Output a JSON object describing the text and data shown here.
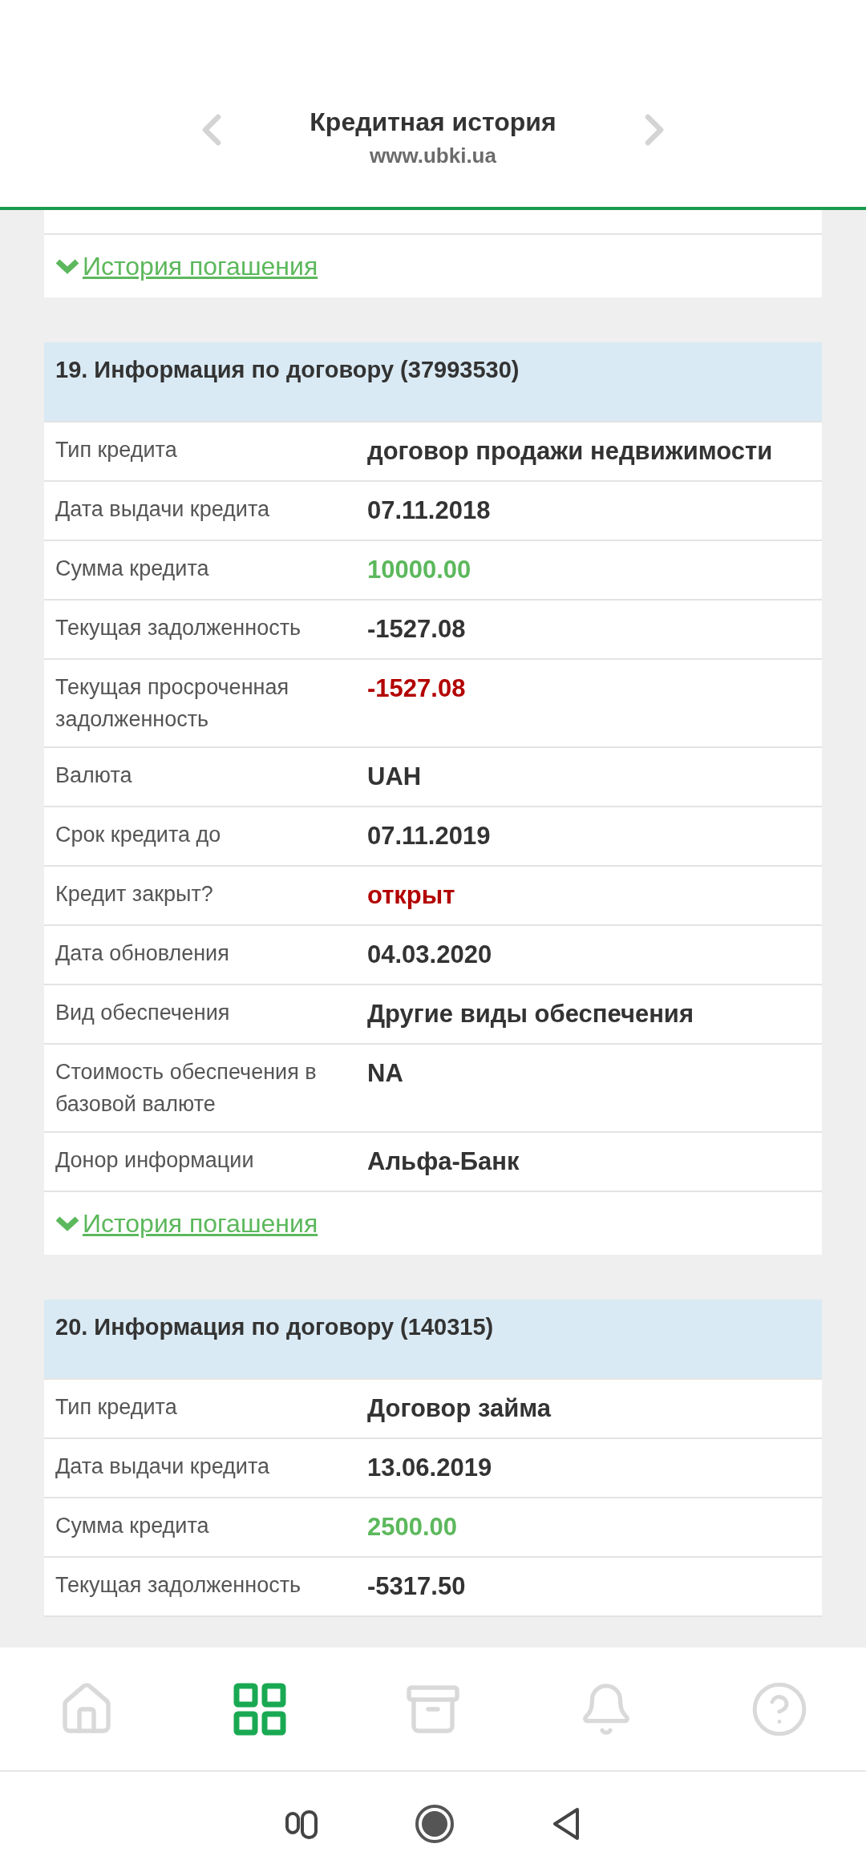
{
  "header": {
    "title": "Кредитная история",
    "url": "www.ubki.ua"
  },
  "contracts": [
    {
      "link": "История погашения"
    },
    {
      "title": "19. Информация по договору (37993530)",
      "rows": [
        {
          "label": "Тип кредита",
          "value": "договор продажи недвижимости",
          "color": "#333333"
        },
        {
          "label": "Дата выдачи кредита",
          "value": "07.11.2018",
          "color": "#333333"
        },
        {
          "label": "Сумма кредита",
          "value": "10000.00",
          "color": "#5cb85c"
        },
        {
          "label": "Текущая задолженность",
          "value": "-1527.08",
          "color": "#333333"
        },
        {
          "label": "Текущая просроченная задолженность",
          "value": "-1527.08",
          "color": "#b30000"
        },
        {
          "label": "Валюта",
          "value": "UAH",
          "color": "#333333"
        },
        {
          "label": "Срок кредита до",
          "value": "07.11.2019",
          "color": "#333333"
        },
        {
          "label": "Кредит закрыт?",
          "value": "открыт",
          "color": "#b30000"
        },
        {
          "label": "Дата обновления",
          "value": "04.03.2020",
          "color": "#333333"
        },
        {
          "label": "Вид обеспечения",
          "value": "Другие виды обеспечения",
          "color": "#333333"
        },
        {
          "label": "Стоимость обеспечения в базовой валюте",
          "value": "NA",
          "color": "#333333"
        },
        {
          "label": "Донор информации",
          "value": "Альфа-Банк",
          "color": "#333333"
        }
      ],
      "link": "История погашения"
    },
    {
      "title": "20. Информация по договору (140315)",
      "rows": [
        {
          "label": "Тип кредита",
          "value": "Договор займа",
          "color": "#333333"
        },
        {
          "label": "Дата выдачи кредита",
          "value": "13.06.2019",
          "color": "#333333"
        },
        {
          "label": "Сумма кредита",
          "value": "2500.00",
          "color": "#5cb85c"
        },
        {
          "label": "Текущая задолженность",
          "value": "-5317.50",
          "color": "#333333"
        }
      ]
    }
  ],
  "nav": [
    {
      "kind": "home",
      "selected": false
    },
    {
      "kind": "grid",
      "selected": true
    },
    {
      "kind": "archive",
      "selected": false
    },
    {
      "kind": "bell",
      "selected": false
    },
    {
      "kind": "help",
      "selected": false
    }
  ]
}
